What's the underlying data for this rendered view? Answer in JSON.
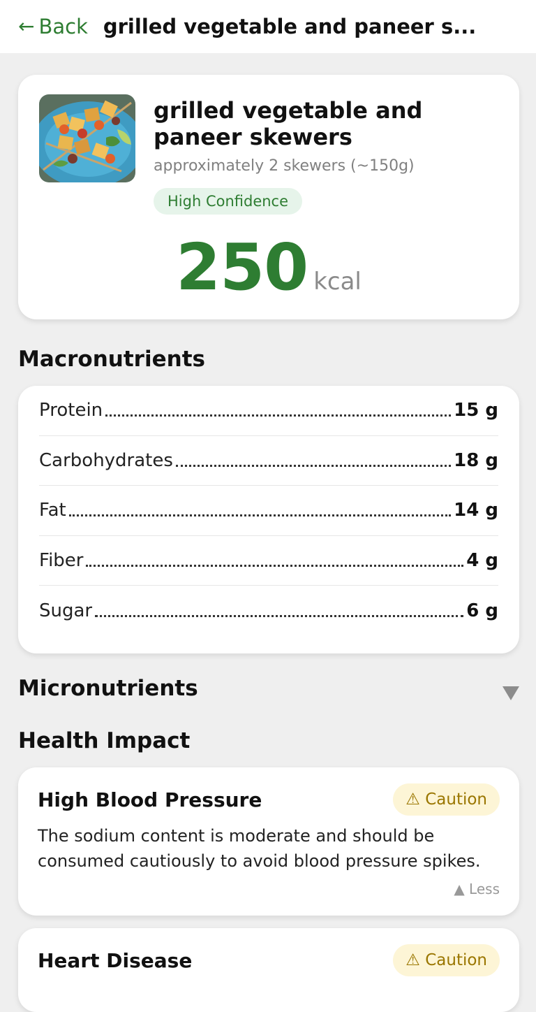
{
  "header": {
    "back_label": "Back",
    "title": "grilled vegetable and paneer s..."
  },
  "food": {
    "name": "grilled vegetable and paneer skewers",
    "portion": "approximately 2 skewers (~150g)",
    "confidence": "High Confidence",
    "calories": "250",
    "calories_unit": "kcal"
  },
  "macros": {
    "title": "Macronutrients",
    "items": [
      {
        "label": "Protein",
        "value": "15 g"
      },
      {
        "label": "Carbohydrates",
        "value": "18 g"
      },
      {
        "label": "Fat",
        "value": "14 g"
      },
      {
        "label": "Fiber",
        "value": "4 g"
      },
      {
        "label": "Sugar",
        "value": "6 g"
      }
    ]
  },
  "micros": {
    "title": "Micronutrients",
    "toggle_icon": "triangle-down-icon"
  },
  "health_impact": {
    "title": "Health Impact",
    "items": [
      {
        "title": "High Blood Pressure",
        "badge": "⚠ Caution",
        "text": "The sodium content is moderate and should be consumed cautiously to avoid blood pressure spikes.",
        "less_label": "▲ Less"
      },
      {
        "title": "Heart Disease",
        "badge": "⚠ Caution"
      }
    ]
  },
  "colors": {
    "accent": "#2e7d32",
    "caution_bg": "#fdf5d6",
    "caution_text": "#9a7600",
    "confidence_bg": "#e6f4ea"
  }
}
